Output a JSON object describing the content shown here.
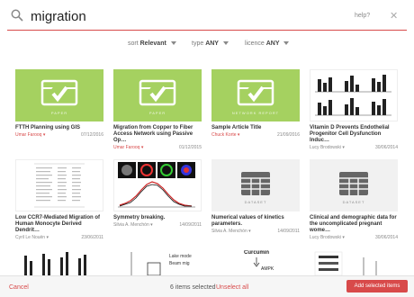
{
  "search": {
    "value": "migration",
    "help": "help?",
    "close": "✕"
  },
  "filters": [
    {
      "label": "sort",
      "value": "Relevant"
    },
    {
      "label": "type",
      "value": "ANY"
    },
    {
      "label": "licence",
      "value": "ANY"
    }
  ],
  "cards": [
    {
      "title": "FTTH Planning using GIS",
      "author": "Umar Farooq ▾",
      "date": "07/12/2016",
      "thumb": "green",
      "badge": "PAPER"
    },
    {
      "title": "Migration from Copper to Fiber Access Network using Passive Op…",
      "author": "Umar Farooq ▾",
      "date": "01/12/2015",
      "thumb": "green",
      "badge": "PAPER"
    },
    {
      "title": "Sample Article Title",
      "author": "Chuck Korte ▾",
      "date": "21/09/2016",
      "thumb": "green",
      "badge": "NETWORK REPORT"
    },
    {
      "title": "Vitamin D Prevents Endothelial Progenitor Cell Dysfunction Induc…",
      "author": "Lucy Brodowski ▾",
      "date": "30/06/2014",
      "thumb": "bars"
    },
    {
      "title": "Low CCR7-Mediated Migration of Human Monocyte Derived Dendrit…",
      "author": "Cyril Le Nouën ▾",
      "date": "23/06/2011",
      "thumb": "table"
    },
    {
      "title": "Symmetry breaking.",
      "author": "Silvia A. Menchón ▾",
      "date": "14/09/2011",
      "thumb": "micro"
    },
    {
      "title": "Numerical values of kinetics parameters.",
      "author": "Silvia A. Menchón ▾",
      "date": "14/09/2011",
      "thumb": "dataset",
      "badge": "DATASET"
    },
    {
      "title": "Clinical and demographic data for the uncomplicated pregnant wome…",
      "author": "Lucy Brodowski ▾",
      "date": "30/06/2014",
      "thumb": "dataset",
      "badge": "DATASET"
    }
  ],
  "partial_row": {
    "labels": [
      "Lake mode",
      "Beam mig"
    ],
    "diagram": [
      "Curcumin",
      "AMPK"
    ]
  },
  "footer": {
    "cancel": "Cancel",
    "selected": "6 items selected",
    "unselect": "Unselect all",
    "add": "Add selected items"
  },
  "colors": {
    "accent": "#d84a4a",
    "green": "#a5d160"
  }
}
